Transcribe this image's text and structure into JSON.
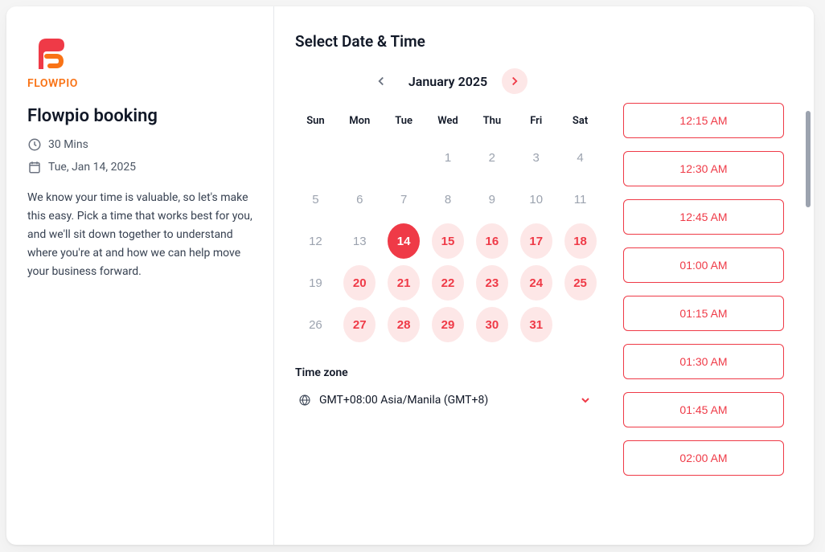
{
  "brand": {
    "name": "FLOWPIO"
  },
  "left": {
    "title": "Flowpio booking",
    "duration": "30 Mins",
    "date": "Tue, Jan 14, 2025",
    "description": "We know your time is valuable, so let's make this easy. Pick a time that works best for you, and we'll sit down together to understand where you're at and how we can help move your business forward."
  },
  "calendar": {
    "heading": "Select Date & Time",
    "month_label": "January 2025",
    "dow": [
      "Sun",
      "Mon",
      "Tue",
      "Wed",
      "Thu",
      "Fri",
      "Sat"
    ],
    "weeks": [
      [
        {
          "n": "",
          "s": "empty"
        },
        {
          "n": "",
          "s": "empty"
        },
        {
          "n": "",
          "s": "empty"
        },
        {
          "n": "1",
          "s": "past"
        },
        {
          "n": "2",
          "s": "past"
        },
        {
          "n": "3",
          "s": "past"
        },
        {
          "n": "4",
          "s": "past"
        }
      ],
      [
        {
          "n": "5",
          "s": "past"
        },
        {
          "n": "6",
          "s": "past"
        },
        {
          "n": "7",
          "s": "past"
        },
        {
          "n": "8",
          "s": "past"
        },
        {
          "n": "9",
          "s": "past"
        },
        {
          "n": "10",
          "s": "past"
        },
        {
          "n": "11",
          "s": "past"
        }
      ],
      [
        {
          "n": "12",
          "s": "past"
        },
        {
          "n": "13",
          "s": "past"
        },
        {
          "n": "14",
          "s": "selected"
        },
        {
          "n": "15",
          "s": "avail"
        },
        {
          "n": "16",
          "s": "avail"
        },
        {
          "n": "17",
          "s": "avail"
        },
        {
          "n": "18",
          "s": "avail"
        }
      ],
      [
        {
          "n": "19",
          "s": "past"
        },
        {
          "n": "20",
          "s": "avail"
        },
        {
          "n": "21",
          "s": "avail"
        },
        {
          "n": "22",
          "s": "avail"
        },
        {
          "n": "23",
          "s": "avail"
        },
        {
          "n": "24",
          "s": "avail"
        },
        {
          "n": "25",
          "s": "avail"
        }
      ],
      [
        {
          "n": "26",
          "s": "past"
        },
        {
          "n": "27",
          "s": "avail"
        },
        {
          "n": "28",
          "s": "avail"
        },
        {
          "n": "29",
          "s": "avail"
        },
        {
          "n": "30",
          "s": "avail"
        },
        {
          "n": "31",
          "s": "avail"
        },
        {
          "n": "",
          "s": "empty"
        }
      ]
    ]
  },
  "timezone": {
    "label": "Time zone",
    "value": "GMT+08:00 Asia/Manila (GMT+8)"
  },
  "slots": [
    "12:15 AM",
    "12:30 AM",
    "12:45 AM",
    "01:00 AM",
    "01:15 AM",
    "01:30 AM",
    "01:45 AM",
    "02:00 AM"
  ]
}
